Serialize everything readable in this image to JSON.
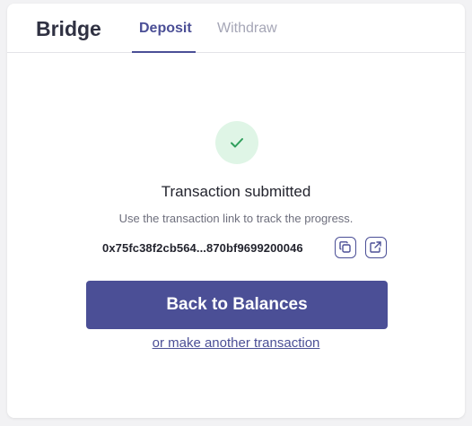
{
  "header": {
    "title": "Bridge",
    "tabs": [
      {
        "label": "Deposit",
        "active": true
      },
      {
        "label": "Withdraw",
        "active": false
      }
    ]
  },
  "status": {
    "icon": "check-icon",
    "heading": "Transaction submitted",
    "subtext": "Use the transaction link to track the progress.",
    "tx_hash": "0x75fc38f2cb564...870bf9699200046"
  },
  "actions": {
    "copy_icon": "copy-icon",
    "open_icon": "external-link-icon",
    "primary_label": "Back to Balances",
    "secondary_label": "or make another transaction"
  },
  "colors": {
    "accent": "#4b4f96",
    "success_bg": "#dff5e6",
    "success_check": "#2e9e5b",
    "text": "#23242e",
    "muted": "#6e6f7d"
  }
}
